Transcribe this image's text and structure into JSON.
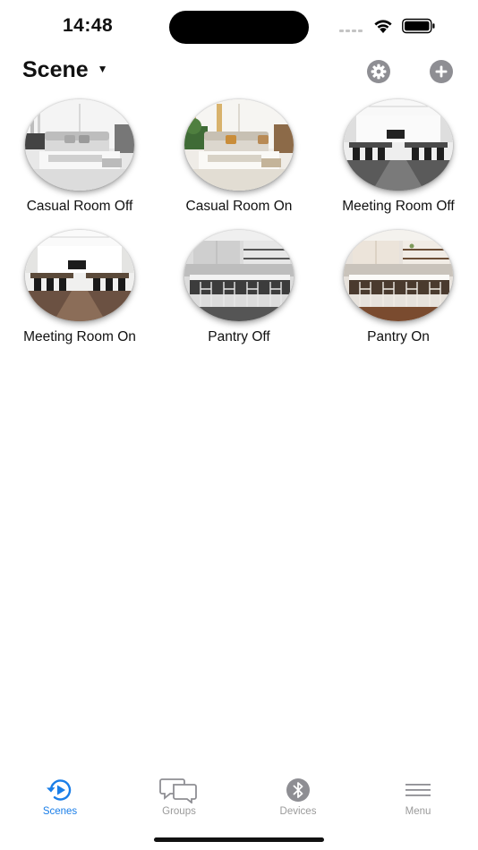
{
  "status_bar": {
    "time": "14:48"
  },
  "header": {
    "title": "Scene",
    "caret": "▼"
  },
  "scenes": [
    {
      "label": "Casual Room Off"
    },
    {
      "label": "Casual Room On"
    },
    {
      "label": "Meeting Room Off"
    },
    {
      "label": "Meeting Room On"
    },
    {
      "label": "Pantry Off"
    },
    {
      "label": "Pantry On"
    }
  ],
  "tabs": [
    {
      "label": "Scenes",
      "icon": "play-circle-icon",
      "active": true
    },
    {
      "label": "Groups",
      "icon": "chat-bubbles-icon",
      "active": false
    },
    {
      "label": "Devices",
      "icon": "bluetooth-icon",
      "active": false
    },
    {
      "label": "Menu",
      "icon": "hamburger-icon",
      "active": false
    }
  ],
  "colors": {
    "accent": "#1a7ee8",
    "inactive": "#9a9a9a",
    "header_icon": "#8e8e93"
  }
}
